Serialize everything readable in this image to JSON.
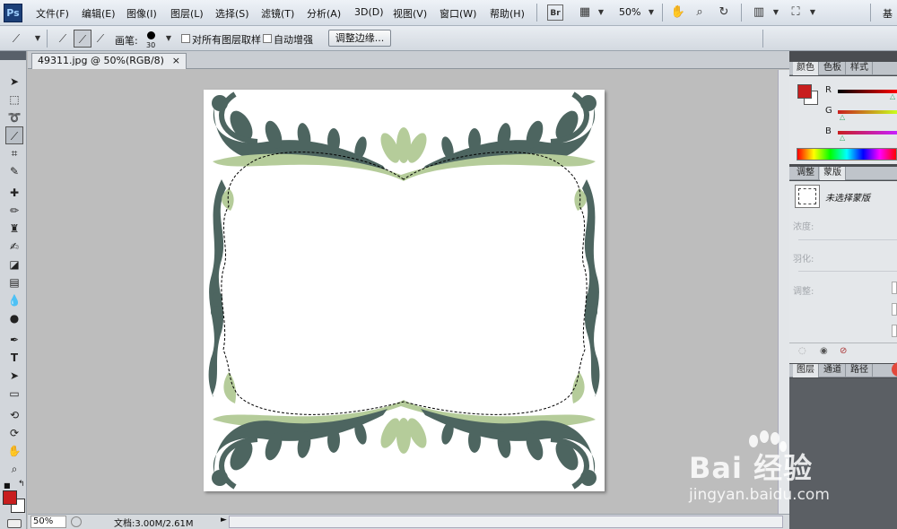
{
  "app": {
    "logo": "Ps"
  },
  "menu": [
    "文件(F)",
    "编辑(E)",
    "图像(I)",
    "图层(L)",
    "选择(S)",
    "滤镜(T)",
    "分析(A)",
    "3D(D)",
    "视图(V)",
    "窗口(W)",
    "帮助(H)"
  ],
  "menubar_extra": {
    "bridge": "Br",
    "zoom": "50%",
    "workspace": "基"
  },
  "options": {
    "brush_label": "画笔:",
    "brush_size": "30",
    "sample_all_label": "对所有图层取样",
    "auto_enhance_label": "自动增强",
    "refine_edge_label": "调整边缘..."
  },
  "document": {
    "tab_title": "49311.jpg @ 50%(RGB/8)",
    "tab_close": "×",
    "zoom": "50%",
    "info": "文档:3.00M/2.61M",
    "status_arrow": "►"
  },
  "colors": {
    "accent_green": "#b5cc9a",
    "dark_teal": "#4d6560",
    "foreground": "#c81e1e",
    "background": "#ffffff"
  },
  "panels": {
    "color_tabs": [
      "颜色",
      "色板",
      "样式"
    ],
    "channels": [
      {
        "label": "R",
        "gradient": "#c00000"
      },
      {
        "label": "G",
        "gradient": "#c00000"
      },
      {
        "label": "B",
        "gradient": "#c00000"
      }
    ],
    "adjust_tabs": [
      "调整",
      "蒙版"
    ],
    "mask_status": "未选择蒙版",
    "density_label": "浓度:",
    "feather_label": "羽化:",
    "refine_label": "调整:",
    "layer_tabs": [
      "图层",
      "通道",
      "路径"
    ]
  },
  "watermark": {
    "brand": "Bai 经验",
    "url": "jingyan.baidu.com"
  }
}
